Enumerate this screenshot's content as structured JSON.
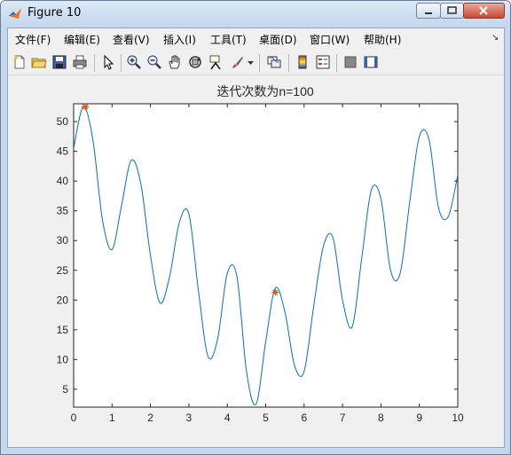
{
  "window": {
    "title": "Figure 10"
  },
  "menu": [
    "文件(F)",
    "编辑(E)",
    "查看(V)",
    "插入(I)",
    "工具(T)",
    "桌面(D)",
    "窗口(W)",
    "帮助(H)"
  ],
  "toolbar": {
    "icons": [
      "new-figure-icon",
      "open-file-icon",
      "save-icon",
      "print-icon",
      "pointer-icon",
      "zoom-in-icon",
      "zoom-out-icon",
      "pan-icon",
      "rotate-3d-icon",
      "data-cursor-icon",
      "brush-icon",
      "link-plot-icon",
      "colorbar-icon",
      "legend-icon",
      "hide-plot-tools-icon",
      "show-plot-tools-icon"
    ]
  },
  "colors": {
    "line": "#0072bd",
    "marker": "#d95319"
  },
  "chart_data": {
    "type": "line",
    "title": "迭代次数为n=100",
    "xlabel": "",
    "ylabel": "",
    "xlim": [
      0,
      10
    ],
    "ylim": [
      2,
      53
    ],
    "xticks": [
      0,
      1,
      2,
      3,
      4,
      5,
      6,
      7,
      8,
      9,
      10
    ],
    "yticks": [
      5,
      10,
      15,
      20,
      25,
      30,
      35,
      40,
      45,
      50
    ],
    "grid": false,
    "series": [
      {
        "x": [
          0,
          0.25,
          0.5,
          0.75,
          1.0,
          1.25,
          1.5,
          1.75,
          2.0,
          2.25,
          2.5,
          2.75,
          3.0,
          3.25,
          3.5,
          3.75,
          4.0,
          4.25,
          4.5,
          4.75,
          5.0,
          5.25,
          5.5,
          5.75,
          6.0,
          6.25,
          6.5,
          6.75,
          7.0,
          7.25,
          7.5,
          7.75,
          8.0,
          8.25,
          8.5,
          8.75,
          9.0,
          9.25,
          9.5,
          9.75,
          10.0
        ],
        "y": [
          45.5,
          52.5,
          47,
          33.5,
          28.5,
          36,
          43.5,
          39.5,
          27.5,
          19.5,
          24,
          33,
          34.5,
          21.5,
          10.5,
          13.5,
          24.5,
          24,
          8,
          2.5,
          13,
          22,
          18,
          9,
          8,
          19,
          29,
          30.5,
          20,
          15.5,
          27,
          38.5,
          37,
          25,
          24.5,
          36.5,
          47.5,
          47,
          35.5,
          34,
          41
        ]
      }
    ],
    "markers": [
      {
        "x": 0.3,
        "y": 52.5
      },
      {
        "x": 5.25,
        "y": 21.3
      }
    ]
  }
}
